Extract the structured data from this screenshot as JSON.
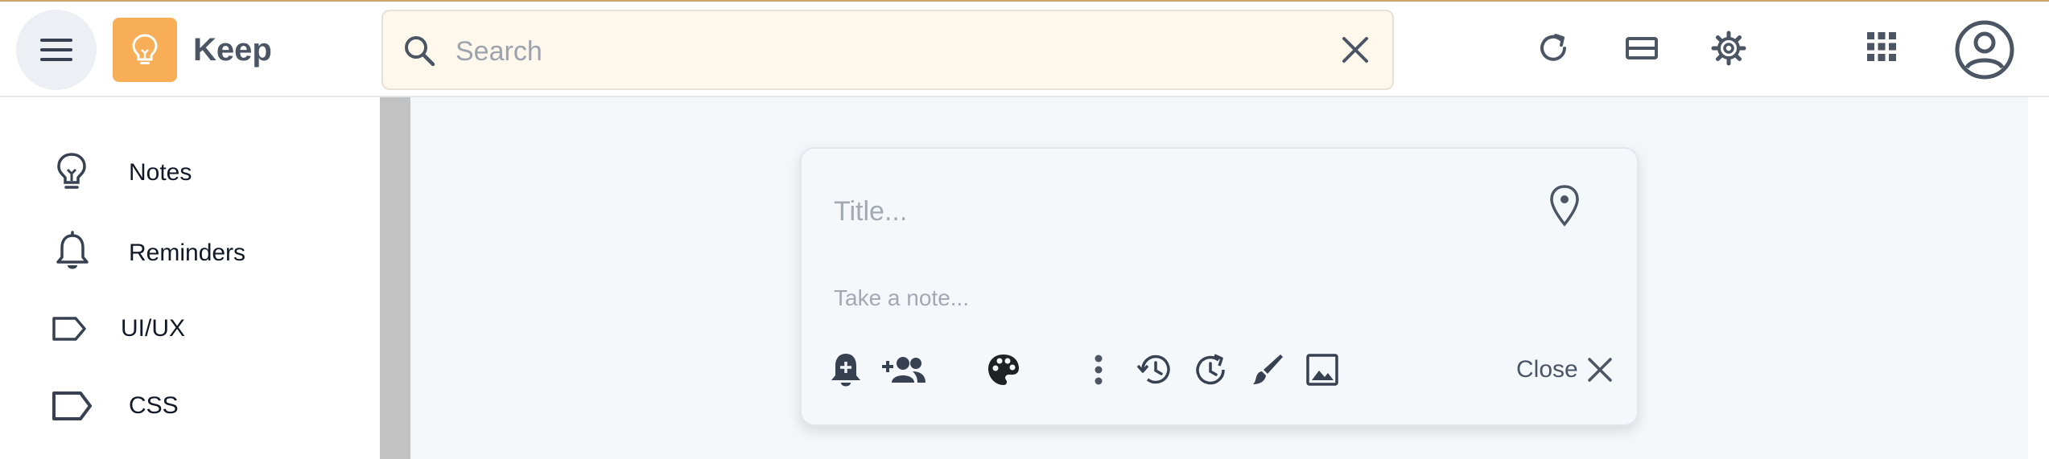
{
  "app": {
    "title": "Keep"
  },
  "search": {
    "placeholder": "Search",
    "value": ""
  },
  "header_icons": [
    "menu-icon",
    "lightbulb-icon",
    "search-icon",
    "clear-search-icon",
    "refresh-icon",
    "list-view-icon",
    "settings-icon",
    "apps-grid-icon",
    "account-icon"
  ],
  "sidebar": {
    "items": [
      {
        "label": "Notes",
        "icon": "lightbulb-icon"
      },
      {
        "label": "Reminders",
        "icon": "bell-icon"
      },
      {
        "label": "UI/UX",
        "icon": "label-icon"
      },
      {
        "label": "CSS",
        "icon": "label-icon"
      }
    ]
  },
  "note_editor": {
    "title_placeholder": "Title...",
    "title_value": "",
    "body_placeholder": "Take a note...",
    "body_value": "",
    "tools": [
      "bell-add-icon",
      "add-collaborator-icon",
      "palette-icon",
      "more-vert-icon",
      "undo-history-icon",
      "redo-history-icon",
      "brush-icon",
      "image-icon"
    ],
    "close_label": "Close"
  },
  "colors": {
    "logo_bg": "#f8ae56",
    "search_bg": "#fdf8eb",
    "main_bg": "#f4f7fa",
    "icon_gray": "#6b7280"
  }
}
